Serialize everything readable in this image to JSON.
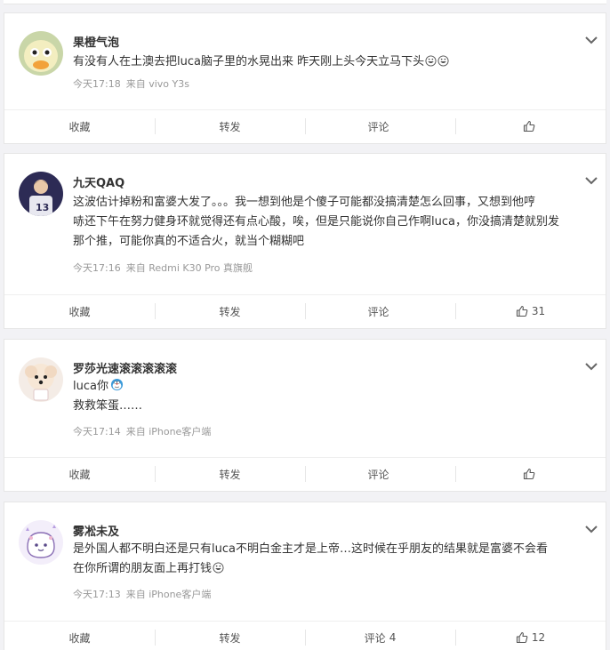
{
  "posts": [
    {
      "username": "果橙气泡",
      "lines": [
        "有没有人在土澳去把luca脑子里的水晃出来 昨天刚上头今天立马下头"
      ],
      "emoji_after": [
        "grin-emoji",
        "grin-emoji"
      ],
      "time": "今天17:18",
      "source": "来自 vivo Y3s",
      "actions": {
        "collect": "收藏",
        "repost": "转发",
        "comment": "评论",
        "comment_count": "",
        "like_count": ""
      }
    },
    {
      "username": "九天QAQ",
      "lines": [
        "这波估计掉粉和富婆大发了。。。我一想到他是个傻子可能都没搞清楚怎么回事，又想到他哼",
        "哧还下午在努力健身环就觉得还有点心酸，唉，但是只能说你自己作啊luca，你没搞清楚就别发",
        "那个推，可能你真的不适合火，就当个糊糊吧"
      ],
      "time": "今天17:16",
      "source": "来自 Redmi K30 Pro 真旗舰",
      "actions": {
        "collect": "收藏",
        "repost": "转发",
        "comment": "评论",
        "comment_count": "",
        "like_count": "31"
      }
    },
    {
      "username": "罗莎光速滚滚滚滚滚",
      "lines": [
        "luca你",
        "救救笨蛋……"
      ],
      "time": "今天17:14",
      "source": "来自 iPhone客户端",
      "actions": {
        "collect": "收藏",
        "repost": "转发",
        "comment": "评论",
        "comment_count": "",
        "like_count": ""
      }
    },
    {
      "username": "雾凇未及",
      "lines": [
        "是外国人都不明白还是只有luca不明白金主才是上帝…这时候在乎朋友的结果就是富婆不会看",
        "在你所谓的朋友面上再打钱"
      ],
      "time": "今天17:13",
      "source": "来自 iPhone客户端",
      "actions": {
        "collect": "收藏",
        "repost": "转发",
        "comment": "评论",
        "comment_count": "4",
        "like_count": "12"
      }
    }
  ],
  "colors": {
    "text": "#333333",
    "meta": "#999999",
    "action": "#555555",
    "page_bg": "#f2f2f5"
  }
}
